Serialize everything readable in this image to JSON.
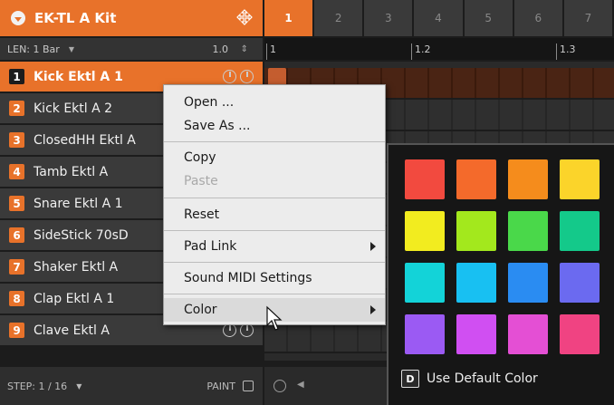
{
  "kit": {
    "title": "EK-TL A Kit"
  },
  "len": {
    "label": "LEN: 1 Bar",
    "value": "1.0"
  },
  "sounds": [
    {
      "num": "1",
      "name": "Kick Ektl A 1"
    },
    {
      "num": "2",
      "name": "Kick Ektl A 2"
    },
    {
      "num": "3",
      "name": "ClosedHH Ektl A"
    },
    {
      "num": "4",
      "name": "Tamb Ektl A"
    },
    {
      "num": "5",
      "name": "Snare Ektl A 1"
    },
    {
      "num": "6",
      "name": "SideStick 70sD"
    },
    {
      "num": "7",
      "name": "Shaker Ektl A"
    },
    {
      "num": "8",
      "name": "Clap Ektl A 1"
    },
    {
      "num": "9",
      "name": "Clave Ektl A"
    }
  ],
  "step": {
    "label": "STEP: 1 / 16",
    "paint": "PAINT"
  },
  "pattern_tabs": [
    "1",
    "2",
    "3",
    "4",
    "5",
    "6",
    "7"
  ],
  "timeline": {
    "m1": "1",
    "m2": "1.2",
    "m3": "1.3"
  },
  "menu": {
    "open": "Open ...",
    "save_as": "Save As ...",
    "copy": "Copy",
    "paste": "Paste",
    "reset": "Reset",
    "pad_link": "Pad Link",
    "sound_midi": "Sound MIDI Settings",
    "color": "Color"
  },
  "colors": [
    "#f24a3f",
    "#f46a2b",
    "#f58c1c",
    "#fbd42a",
    "#f2ec1f",
    "#a3e81d",
    "#4ad84a",
    "#14c98a",
    "#13d3d8",
    "#18c0f2",
    "#2a8cf2",
    "#6b6af0",
    "#9b5af3",
    "#d04ff2",
    "#e44fd4",
    "#f04382"
  ],
  "picker": {
    "default_key": "D",
    "default_label": "Use Default Color"
  }
}
